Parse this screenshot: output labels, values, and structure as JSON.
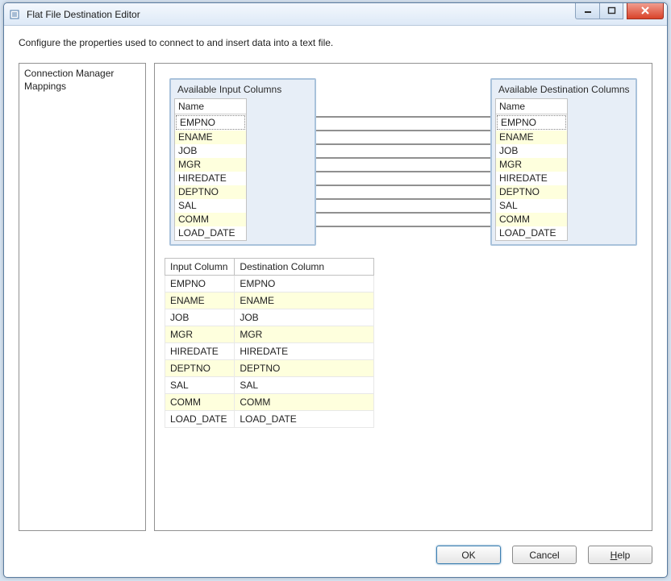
{
  "window": {
    "title": "Flat File Destination Editor"
  },
  "description": "Configure the properties used to connect to and insert data into a text file.",
  "sideNav": {
    "items": [
      "Connection Manager",
      "Mappings"
    ]
  },
  "inputBox": {
    "title": "Available Input Columns",
    "header": "Name",
    "rows": [
      "EMPNO",
      "ENAME",
      "JOB",
      "MGR",
      "HIREDATE",
      "DEPTNO",
      "SAL",
      "COMM",
      "LOAD_DATE"
    ]
  },
  "destBox": {
    "title": "Available Destination Columns",
    "header": "Name",
    "rows": [
      "EMPNO",
      "ENAME",
      "JOB",
      "MGR",
      "HIREDATE",
      "DEPTNO",
      "SAL",
      "COMM",
      "LOAD_DATE"
    ]
  },
  "mappingGrid": {
    "headers": [
      "Input Column",
      "Destination Column"
    ],
    "rows": [
      {
        "in": "EMPNO",
        "out": "EMPNO"
      },
      {
        "in": "ENAME",
        "out": "ENAME"
      },
      {
        "in": "JOB",
        "out": "JOB"
      },
      {
        "in": "MGR",
        "out": "MGR"
      },
      {
        "in": "HIREDATE",
        "out": "HIREDATE"
      },
      {
        "in": "DEPTNO",
        "out": "DEPTNO"
      },
      {
        "in": "SAL",
        "out": "SAL"
      },
      {
        "in": "COMM",
        "out": "COMM"
      },
      {
        "in": "LOAD_DATE",
        "out": "LOAD_DATE"
      }
    ]
  },
  "buttons": {
    "ok": "OK",
    "cancel": "Cancel",
    "help": "Help"
  }
}
